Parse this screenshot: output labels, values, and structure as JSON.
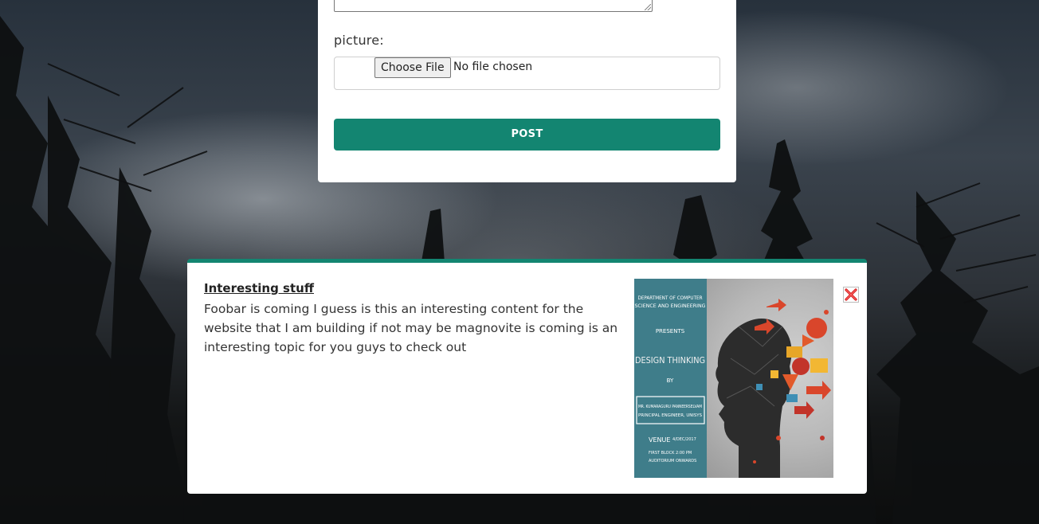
{
  "form": {
    "picture_label": "picture:",
    "file_input": {
      "button_label": "Choose File",
      "status_text": "No file chosen"
    },
    "post_button_label": "POST"
  },
  "post": {
    "title": "Interesting stuff",
    "body": "Foobar is coming I guess is this an interesting content for the website that I am building if not may be magnovite is coming is an interesting topic for you guys to check out",
    "image": {
      "dept_line_1": "DEPARTMENT OF COMPUTER",
      "dept_line_2": "SCIENCE AND ENGINEERING",
      "presents": "PRESENTS",
      "headline": "DESIGN THINKING",
      "by": "BY",
      "speaker_line_1": "MR. KUMARAGURU PANNEERSELVAM",
      "speaker_line_2": "PRINCIPAL ENGINEER, UNISYS",
      "venue_label": "VENUE",
      "venue_line_1": "FIRST BLOCK",
      "venue_line_2": "AUDITORIUM",
      "date": "4/DEC/2017",
      "time_line_1": "2:00 PM",
      "time_line_2": "ONWARDS"
    },
    "close_icon": "close-icon"
  },
  "colors": {
    "accent": "#138571",
    "close_red": "#d62020"
  }
}
